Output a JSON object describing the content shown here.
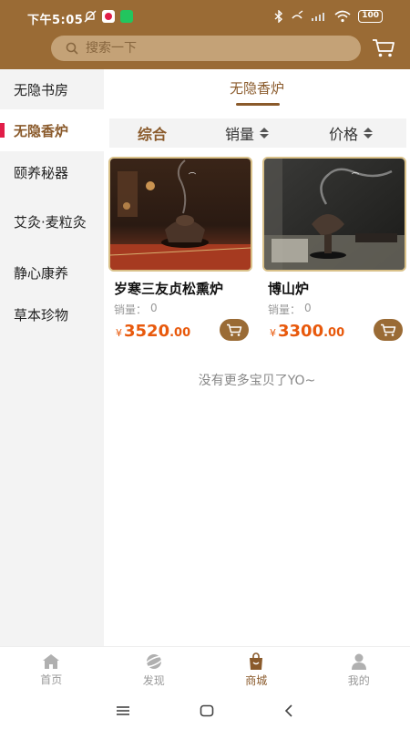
{
  "status_bar": {
    "time": "下午5:05",
    "battery": "100"
  },
  "header": {
    "search_placeholder": "搜索一下"
  },
  "sidebar": {
    "items": [
      {
        "label": "无隐书房",
        "active": false
      },
      {
        "label": "无隐香炉",
        "active": true
      },
      {
        "label": "颐养秘器",
        "active": false
      },
      {
        "label": "艾灸·麦粒灸",
        "active": false
      },
      {
        "label": "静心康养",
        "active": false
      },
      {
        "label": "草本珍物",
        "active": false
      }
    ]
  },
  "main": {
    "title": "无隐香炉",
    "sort": {
      "comprehensive": "综合",
      "sales": "销量",
      "price": "价格"
    },
    "products": [
      {
        "name": "岁寒三友贞松熏炉",
        "sales_label": "销量：",
        "sales_value": "0",
        "currency": "¥",
        "price_int": "3520",
        "price_dec": ".00"
      },
      {
        "name": "博山炉",
        "sales_label": "销量：",
        "sales_value": "0",
        "currency": "¥",
        "price_int": "3300",
        "price_dec": ".00"
      }
    ],
    "no_more": "没有更多宝贝了YO~"
  },
  "tabbar": {
    "items": [
      {
        "label": "首页",
        "icon": "home-icon"
      },
      {
        "label": "发现",
        "icon": "planet-icon"
      },
      {
        "label": "商城",
        "icon": "shopping-bag-icon",
        "active": true
      },
      {
        "label": "我的",
        "icon": "user-icon"
      }
    ]
  },
  "colors": {
    "brand": "#9a6b35",
    "accent_text": "#8a5a2b",
    "price": "#e8590c",
    "active_mark": "#e11d48"
  }
}
